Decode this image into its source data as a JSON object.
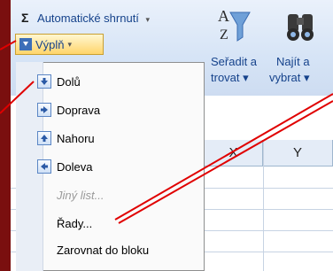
{
  "ribbon": {
    "autosum_label": "Automatické shrnutí",
    "fill_label": "Výplň",
    "sort_label_1": "Seřadit a",
    "sort_label_2": "trovat ▾",
    "find_label_1": "Najít a",
    "find_label_2": "vybrat ▾"
  },
  "grid": {
    "columns": [
      "X",
      "Y"
    ]
  },
  "menu": {
    "items": [
      {
        "label": "Dolů",
        "icon": "arrow-down-icon"
      },
      {
        "label": "Doprava",
        "icon": "arrow-right-icon"
      },
      {
        "label": "Nahoru",
        "icon": "arrow-up-icon"
      },
      {
        "label": "Doleva",
        "icon": "arrow-left-icon"
      },
      {
        "label": "Jiný list...",
        "icon": ""
      },
      {
        "label": "Řady...",
        "icon": ""
      },
      {
        "label": "Zarovnat do bloku",
        "icon": ""
      }
    ]
  },
  "colors": {
    "frame": "#7a0f0f",
    "callout": "#e00000",
    "ribbon_text": "#15428b"
  }
}
